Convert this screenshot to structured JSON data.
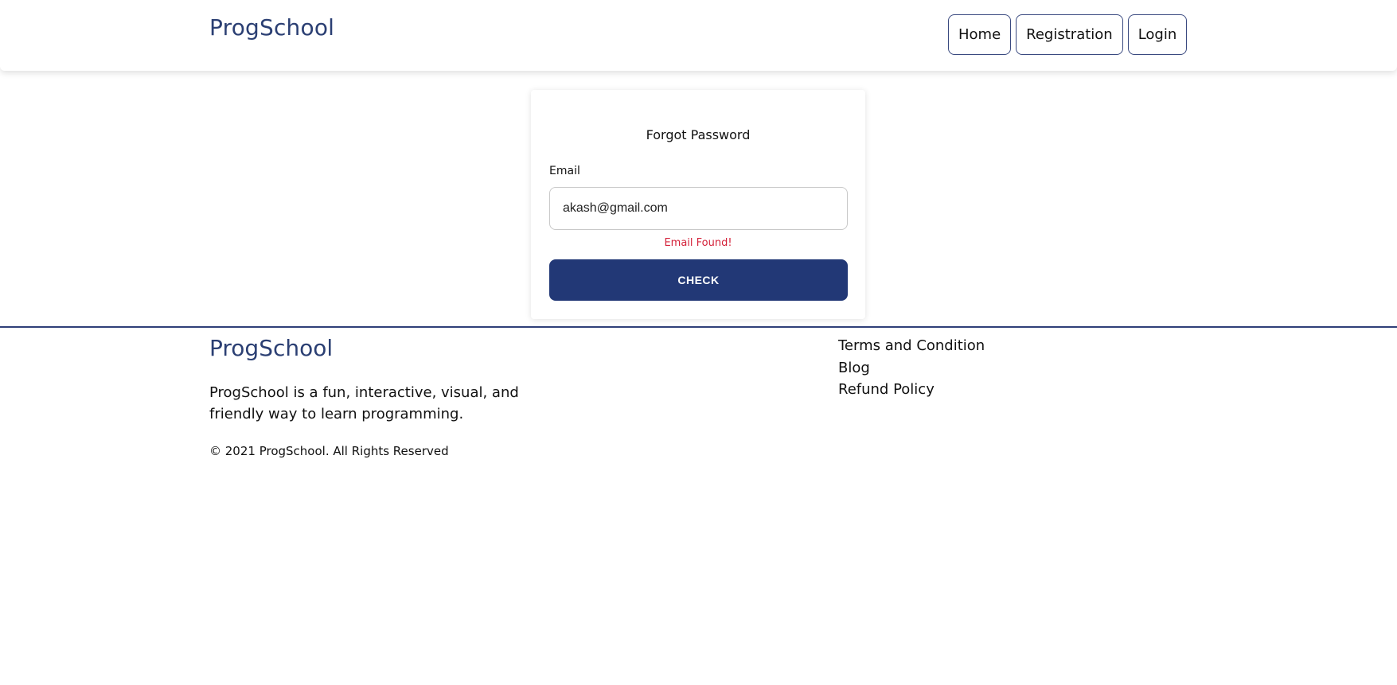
{
  "header": {
    "brand": "ProgSchool",
    "nav": [
      {
        "label": "Home"
      },
      {
        "label": "Registration"
      },
      {
        "label": "Login"
      }
    ]
  },
  "form": {
    "title": "Forgot Password",
    "email_label": "Email",
    "email_value": "akash@gmail.com",
    "status_message": "Email Found!",
    "submit_label": "CHECK"
  },
  "footer": {
    "brand": "ProgSchool",
    "description": "ProgSchool is a fun, interactive, visual, and friendly way to learn programming.",
    "copyright": "© 2021 ProgSchool. All Rights Reserved",
    "links": [
      {
        "label": "Terms and Condition"
      },
      {
        "label": "Blog"
      },
      {
        "label": "Refund Policy"
      }
    ]
  },
  "colors": {
    "brand": "#2b3f73",
    "primary_button": "#223876",
    "status_success_text": "#d4223a",
    "divider": "#2f3f78"
  }
}
